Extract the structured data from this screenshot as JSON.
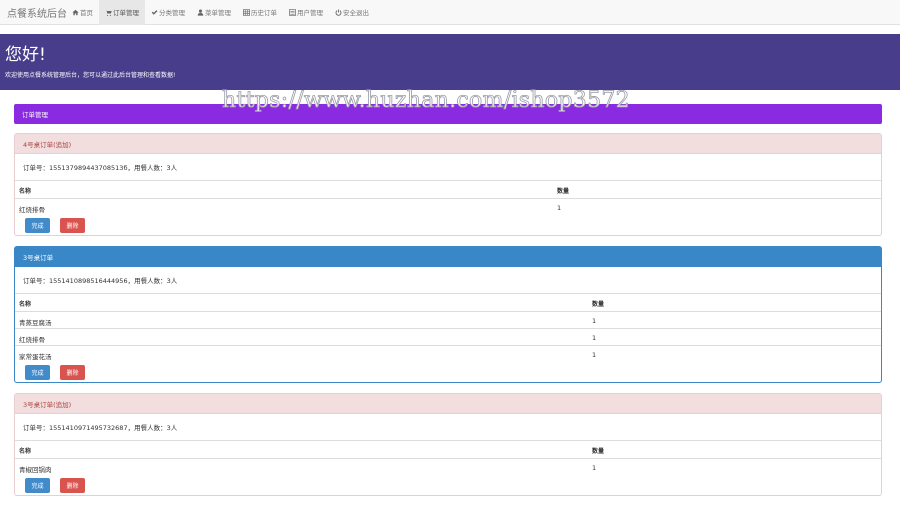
{
  "navbar": {
    "brand": "点餐系统后台",
    "items": [
      {
        "label": "首页",
        "icon": "home-icon"
      },
      {
        "label": "订单管理",
        "icon": "cart-icon",
        "active": true
      },
      {
        "label": "分类管理",
        "icon": "check-icon"
      },
      {
        "label": "菜单管理",
        "icon": "user-icon"
      },
      {
        "label": "历史订单",
        "icon": "grid-icon"
      },
      {
        "label": "用户管理",
        "icon": "list-icon"
      },
      {
        "label": "安全退出",
        "icon": "power-icon"
      }
    ]
  },
  "jumbotron": {
    "title": "您好!",
    "subtitle": "欢迎使用点餐系统管理后台，您可以通过此后台管理和查看数据!"
  },
  "watermark": "https://www.huzhan.com/ishop3572",
  "panel_title": "订单管理",
  "orders": [
    {
      "title": "4号桌订单(追加)",
      "info": "订单号：155137989443708513б，用餐人数：3人",
      "col_name": "名称",
      "col_qty": "数量",
      "items": [
        {
          "name": "红烧排骨",
          "qty": "1"
        }
      ],
      "done_label": "完成",
      "delete_label": "删除"
    },
    {
      "title": "3号桌订单",
      "info": "订单号：1551410898516444956，用餐人数：3人",
      "col_name": "名称",
      "col_qty": "数量",
      "items": [
        {
          "name": "青蒸豆腐汤",
          "qty": "1"
        },
        {
          "name": "红烧排骨",
          "qty": "1"
        },
        {
          "name": "家常蛋花汤",
          "qty": "1"
        }
      ],
      "done_label": "完成",
      "delete_label": "删除"
    },
    {
      "title": "3号桌订单(追加)",
      "info": "订单号：1551410971495732687，用餐人数：3人",
      "col_name": "名称",
      "col_qty": "数量",
      "items": [
        {
          "name": "青椒回锅肉",
          "qty": "1"
        }
      ],
      "done_label": "完成",
      "delete_label": "删除"
    }
  ],
  "colors": {
    "jumbotron": "#483d8b",
    "panel_purple": "#8a2be2",
    "danger_head": "#f2dede",
    "primary_head": "#3a87c7",
    "btn_done": "#428bca",
    "btn_delete": "#d9534f"
  }
}
